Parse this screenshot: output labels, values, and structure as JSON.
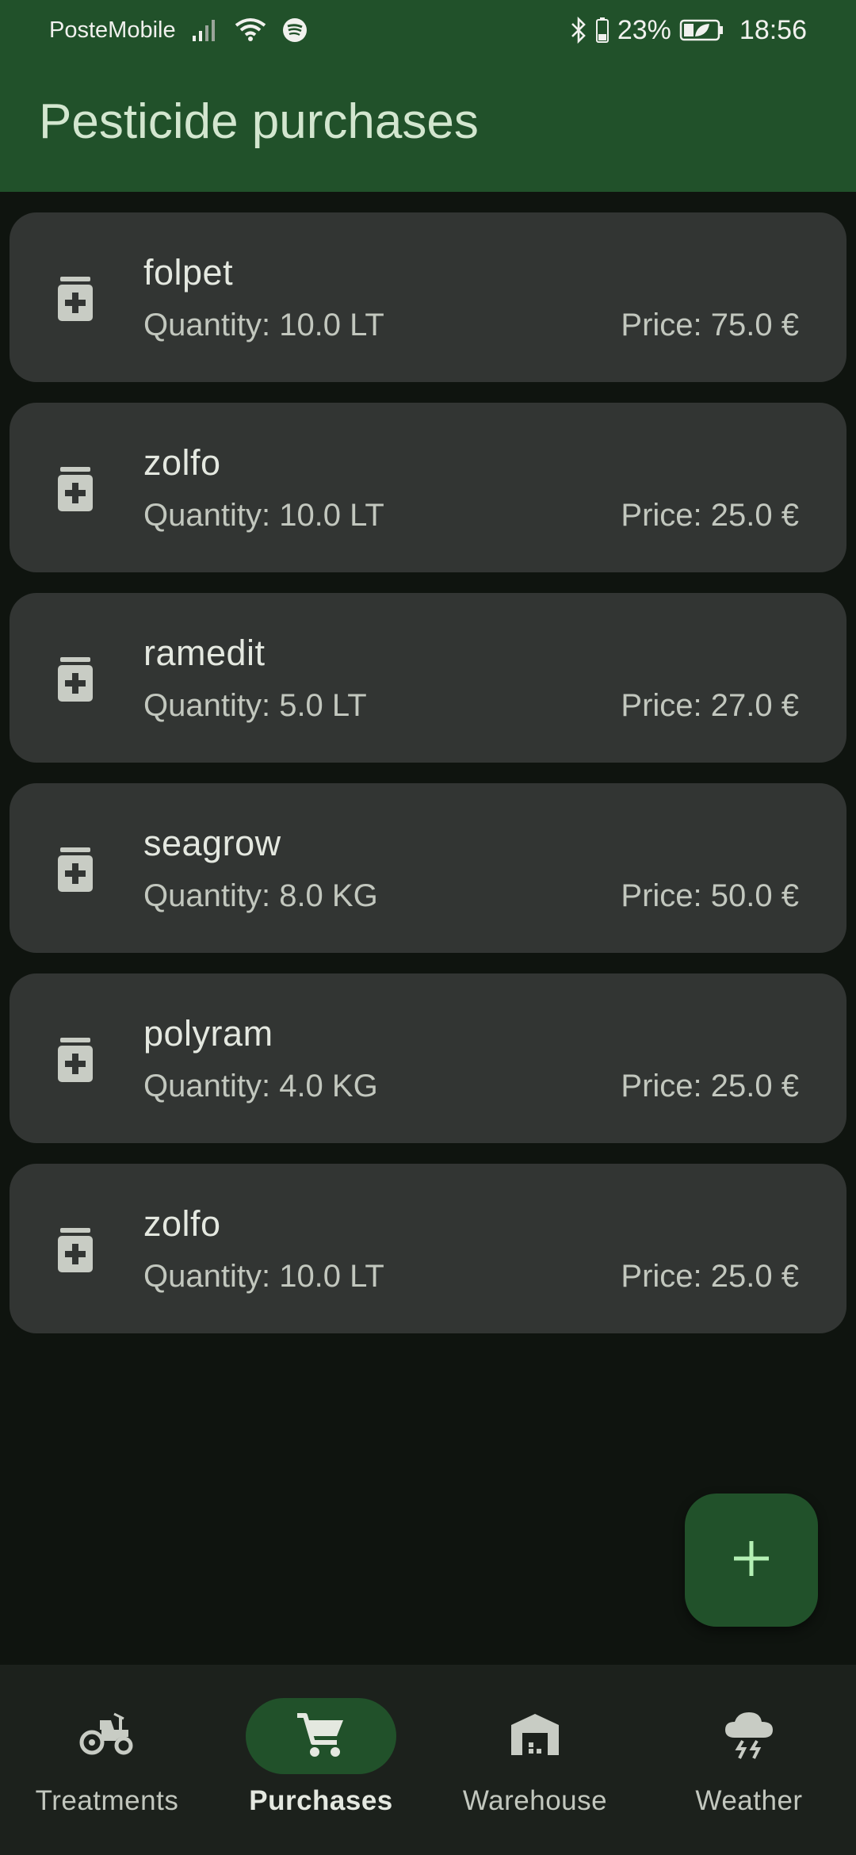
{
  "status_bar": {
    "carrier": "PosteMobile",
    "battery": "23%",
    "time": "18:56"
  },
  "app_bar": {
    "title": "Pesticide purchases"
  },
  "purchases": [
    {
      "name": "folpet",
      "quantity": "Quantity: 10.0 LT",
      "price": "Price: 75.0 €"
    },
    {
      "name": "zolfo",
      "quantity": "Quantity: 10.0 LT",
      "price": "Price: 25.0 €"
    },
    {
      "name": "ramedit",
      "quantity": "Quantity: 5.0 LT",
      "price": "Price: 27.0 €"
    },
    {
      "name": "seagrow",
      "quantity": "Quantity: 8.0 KG",
      "price": "Price: 50.0 €"
    },
    {
      "name": "polyram",
      "quantity": "Quantity: 4.0 KG",
      "price": "Price: 25.0 €"
    },
    {
      "name": "zolfo",
      "quantity": "Quantity: 10.0 LT",
      "price": "Price: 25.0 €"
    }
  ],
  "fab": {
    "icon": "plus-icon"
  },
  "bottom_nav": {
    "items": [
      {
        "label": "Treatments",
        "icon": "tractor-icon",
        "active": false
      },
      {
        "label": "Purchases",
        "icon": "shopping-cart-icon",
        "active": true
      },
      {
        "label": "Warehouse",
        "icon": "warehouse-icon",
        "active": false
      },
      {
        "label": "Weather",
        "icon": "thunderstorm-icon",
        "active": false
      }
    ]
  },
  "colors": {
    "primary_container": "#21512a",
    "background": "#0f140f",
    "card": "#323533",
    "nav_background": "#1c211c",
    "on_primary_container": "#d3e6cf",
    "fab_icon": "#b4f0b4"
  }
}
